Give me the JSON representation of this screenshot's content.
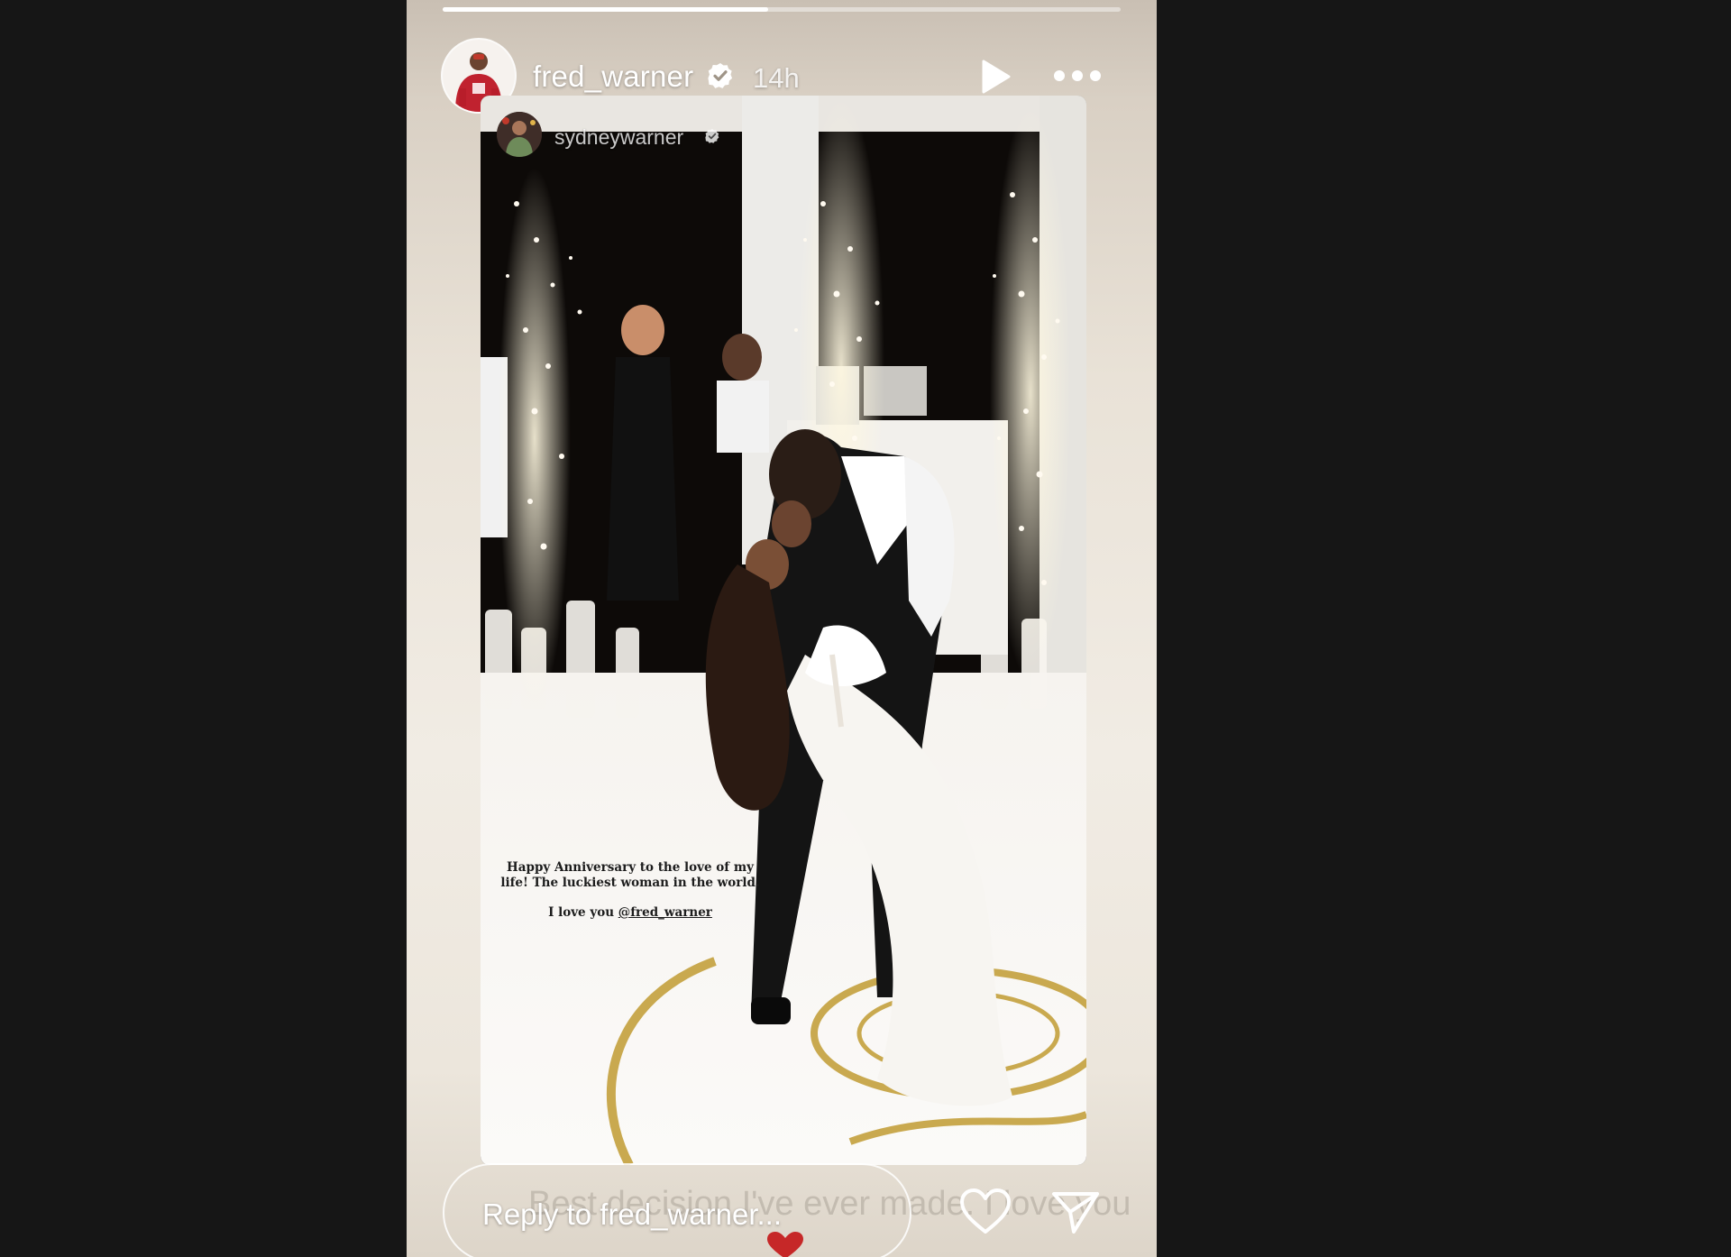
{
  "story": {
    "progress": 0.48,
    "author": "fred_warner",
    "verified": true,
    "time_ago": "14h",
    "play_icon": "play-icon",
    "more_icon": "more-horizontal-icon"
  },
  "reshared_post": {
    "author": "sydneywarner",
    "verified": true,
    "caption_line1": "Happy Anniversary to the love of my life! The luckiest woman in the world.",
    "caption_line2_prefix": "I love you ",
    "caption_mention": "@fred_warner"
  },
  "overlay_text": "Best decision I've ever made. I love you",
  "reply": {
    "placeholder": "Reply to fred_warner...",
    "like_icon": "heart-outline-icon",
    "send_icon": "send-icon",
    "reaction_icon": "red-heart-icon"
  },
  "colors": {
    "viewer_background": "#161616",
    "gold_accent": "#c9a94f",
    "heart_red": "#c62828"
  }
}
